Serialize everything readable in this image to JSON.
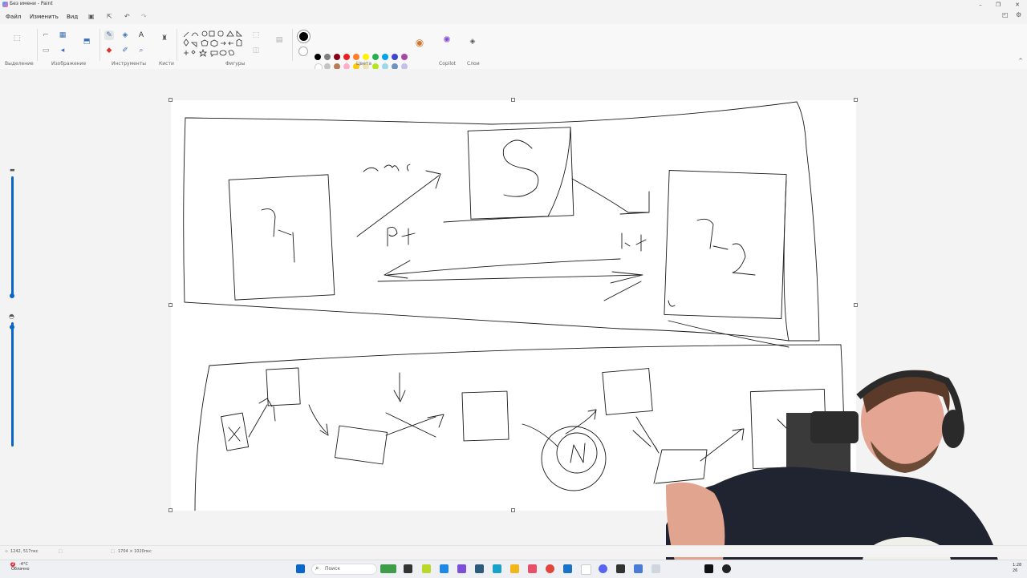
{
  "window": {
    "title": "Без имени - Paint",
    "controls": [
      "–",
      "❐",
      "✕"
    ]
  },
  "menu": {
    "file": "Файл",
    "edit": "Изменить",
    "view": "Вид"
  },
  "ribbon": {
    "groups": {
      "selection": "Выделение",
      "image": "Изображение",
      "tools": "Инструменты",
      "brushes": "Кисти",
      "shapes": "Фигуры",
      "colors": "Цвета",
      "copilot": "Copilot",
      "layers": "Слои"
    },
    "palette_row1": [
      "#000000",
      "#7f7f7f",
      "#880015",
      "#ed1c24",
      "#ff7f27",
      "#fff200",
      "#22b14c",
      "#00a2e8",
      "#3f48cc",
      "#a349a4"
    ],
    "palette_row2": [
      "#ffffff",
      "#c3c3c3",
      "#b97a57",
      "#ffaec9",
      "#ffc90e",
      "#efe4b0",
      "#b5e61d",
      "#99d9ea",
      "#7092be",
      "#c8bfe7"
    ],
    "palette_empty_count": 10,
    "current_color": "#000000"
  },
  "canvas": {
    "labels": {
      "cmc": "СМС",
      "s": "S",
      "pk_left": "Рк",
      "pk_right": "Рк",
      "y1": "У₁",
      "y2": "У₂",
      "n": "N"
    }
  },
  "status": {
    "cursor_pos": "1242, 517пкс",
    "canvas_size": "1704 × 1020пкс"
  },
  "taskbar": {
    "weather_temp": "-4°C",
    "weather_desc": "Облачно",
    "weather_badge": "2",
    "search_placeholder": "Поиск",
    "time": "1:28",
    "date": "26"
  },
  "zoom": {
    "upper_slider_level": 0.95,
    "lower_slider_level": 0.1
  }
}
